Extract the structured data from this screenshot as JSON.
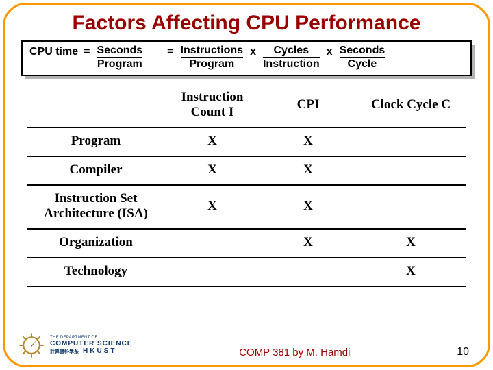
{
  "title": "Factors Affecting CPU Performance",
  "equation": {
    "lhs": "CPU time",
    "eq1_top": "Seconds",
    "eq1_bot": "Program",
    "eq2a_top": "Instructions",
    "eq2a_bot": "Program",
    "times1": "x",
    "eq2b_top": "Cycles",
    "eq2b_bot": "Instruction",
    "times2": "x",
    "eq2c_top": "Seconds",
    "eq2c_bot": "Cycle"
  },
  "columns": {
    "c1": "Instruction Count I",
    "c2": "CPI",
    "c3": "Clock Cycle C"
  },
  "rows": [
    {
      "label": "Program",
      "c1": "X",
      "c2": "X",
      "c3": ""
    },
    {
      "label": "Compiler",
      "c1": "X",
      "c2": "X",
      "c3": ""
    },
    {
      "label": "Instruction Set Architecture (ISA)",
      "c1": "X",
      "c2": "X",
      "c3": ""
    },
    {
      "label": "Organization",
      "c1": "",
      "c2": "X",
      "c3": "X"
    },
    {
      "label": "Technology",
      "c1": "",
      "c2": "",
      "c3": "X"
    }
  ],
  "footer": {
    "dept_prefix": "THE DEPARTMENT OF",
    "dept_main": "COMPUTER SCIENCE",
    "dept_uni1": "計算機科學系",
    "dept_uni2": "HKUST",
    "center": "COMP 381 by M. Hamdi",
    "page": "10"
  }
}
